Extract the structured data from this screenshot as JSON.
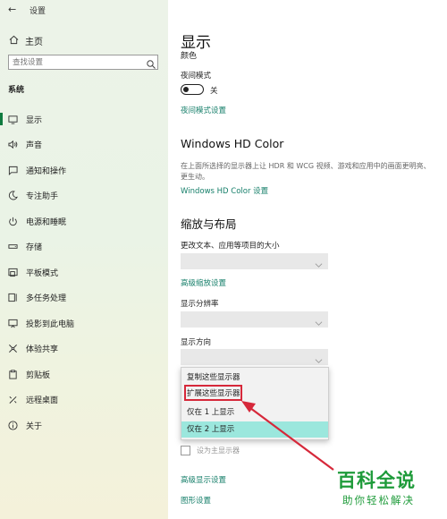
{
  "window": {
    "title": "设置"
  },
  "sidebar": {
    "home_label": "主页",
    "search_placeholder": "查找设置",
    "section": "系统",
    "items": [
      {
        "label": "显示",
        "icon": "monitor-icon",
        "active": true
      },
      {
        "label": "声音",
        "icon": "speaker-icon"
      },
      {
        "label": "通知和操作",
        "icon": "notification-icon"
      },
      {
        "label": "专注助手",
        "icon": "moon-icon"
      },
      {
        "label": "电源和睡眠",
        "icon": "power-icon"
      },
      {
        "label": "存储",
        "icon": "storage-icon"
      },
      {
        "label": "平板模式",
        "icon": "tablet-icon"
      },
      {
        "label": "多任务处理",
        "icon": "multitask-icon"
      },
      {
        "label": "投影到此电脑",
        "icon": "project-icon"
      },
      {
        "label": "体验共享",
        "icon": "share-icon"
      },
      {
        "label": "剪贴板",
        "icon": "clipboard-icon"
      },
      {
        "label": "远程桌面",
        "icon": "remote-icon"
      },
      {
        "label": "关于",
        "icon": "info-icon"
      }
    ]
  },
  "main": {
    "title": "显示",
    "color_label": "颜色",
    "night_mode_label": "夜间模式",
    "night_mode_state": "关",
    "night_mode_link": "夜间模式设置",
    "hd_heading": "Windows HD Color",
    "hd_desc": "在上面所选择的显示器上让 HDR 和 WCG 视频、游戏和应用中的画面更明亮、更生动。",
    "hd_link": "Windows HD Color 设置",
    "scale_heading": "缩放与布局",
    "scale_label": "更改文本、应用等项目的大小",
    "advanced_scale_link": "高级缩放设置",
    "resolution_label": "显示分辨率",
    "orientation_label": "显示方向",
    "multi_display_options": [
      {
        "label": "复制这些显示器"
      },
      {
        "label": "扩展这些显示器",
        "highlighted": true
      },
      {
        "label": "仅在 1 上显示"
      },
      {
        "label": "仅在 2 上显示",
        "selected": true
      }
    ],
    "main_display_label": "设为主显示器",
    "advanced_display_link": "高级显示设置",
    "graphics_link": "图形设置"
  },
  "watermark": {
    "brand": "百科全说",
    "slogan": "助你轻松解决"
  },
  "colors": {
    "accent": "#167f6a",
    "selected": "#9be7dd",
    "highlight_box": "#d6283a",
    "arrow": "#d6283a",
    "watermark": "#1e9b3a"
  }
}
